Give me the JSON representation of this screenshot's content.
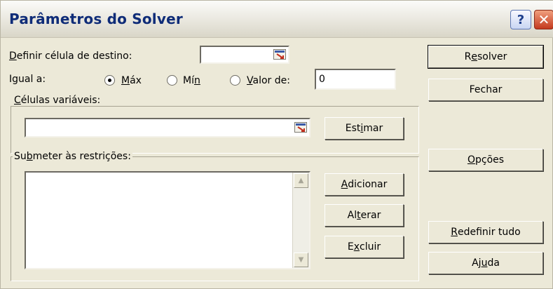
{
  "window": {
    "title": "Parâmetros do Solver",
    "help_label": "?",
    "close_label": "✕"
  },
  "target_cell": {
    "label_pre": "",
    "label_key": "D",
    "label_post": "efinir célula de destino:",
    "value": ""
  },
  "equal_to": {
    "label": "Igual a:",
    "options": [
      {
        "pre": "",
        "key": "M",
        "post": "áx",
        "checked": true
      },
      {
        "pre": "Mí",
        "key": "n",
        "post": "",
        "checked": false
      },
      {
        "pre": "",
        "key": "V",
        "post": "alor de:",
        "checked": false
      }
    ],
    "value_of": "0"
  },
  "variable_cells": {
    "label_pre": "",
    "label_key": "C",
    "label_post": "élulas variáveis:",
    "value": "",
    "estimate_pre": "Est",
    "estimate_key": "i",
    "estimate_post": "mar"
  },
  "constraints": {
    "label_pre": "Su",
    "label_key": "b",
    "label_post": "meter às restrições:",
    "items": [],
    "add_pre": "",
    "add_key": "A",
    "add_post": "dicionar",
    "change_pre": "Al",
    "change_key": "t",
    "change_post": "erar",
    "delete_pre": "E",
    "delete_key": "x",
    "delete_post": "cluir"
  },
  "actions": {
    "solve_pre": "R",
    "solve_key": "e",
    "solve_post": "solver",
    "close": "Fechar",
    "options_pre": "",
    "options_key": "O",
    "options_post": "pções",
    "reset_pre": "",
    "reset_key": "R",
    "reset_post": "edefinir tudo",
    "help_pre": "Aj",
    "help_key": "u",
    "help_post": "da"
  },
  "colors": {
    "title_text": "#0f2c78",
    "dialog_bg": "#ece9d8",
    "refedit_arrow": "#c3301e"
  }
}
